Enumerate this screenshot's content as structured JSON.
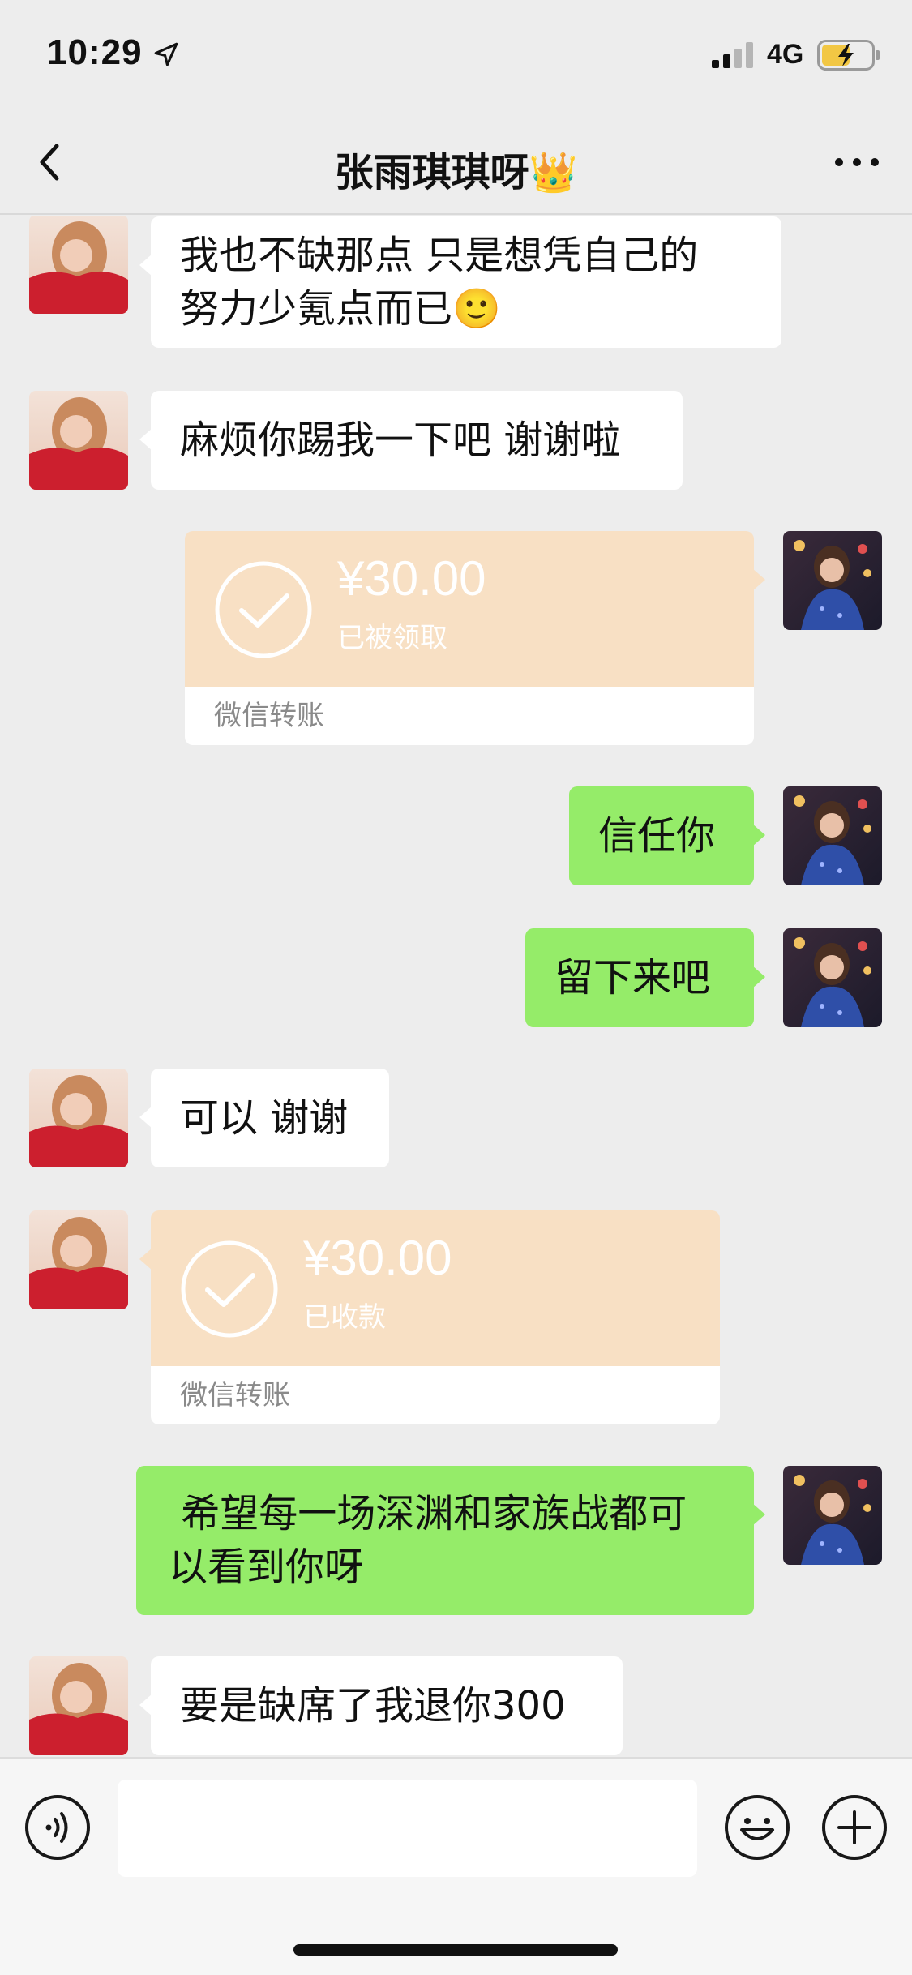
{
  "status_bar": {
    "time": "10:29",
    "network": "4G"
  },
  "nav": {
    "title": "张雨琪琪呀👑"
  },
  "messages": {
    "m1": {
      "text_line1": "我也不缺那点  只是想凭自己的",
      "text_line2": "努力少氪点而已🙂"
    },
    "m2": {
      "text": "麻烦你踢我一下吧 谢谢啦"
    },
    "m3": {
      "amount": "¥30.00",
      "status": "已被领取",
      "label": "微信转账"
    },
    "m4": {
      "text": "信任你"
    },
    "m5": {
      "text": "留下来吧"
    },
    "m6": {
      "text": "可以 谢谢"
    },
    "m7": {
      "amount": "¥30.00",
      "status": "已收款",
      "label": "微信转账"
    },
    "m8": {
      "text_line1": " 希望每一场深渊和家族战都可",
      "text_line2": "以看到你呀"
    },
    "m9": {
      "text": "要是缺席了我退你300"
    }
  },
  "input": {
    "value": ""
  },
  "colors": {
    "own_bubble": "#95ec69",
    "other_bubble": "#ffffff",
    "transfer": "#f8e0c4",
    "background": "#ededed"
  }
}
